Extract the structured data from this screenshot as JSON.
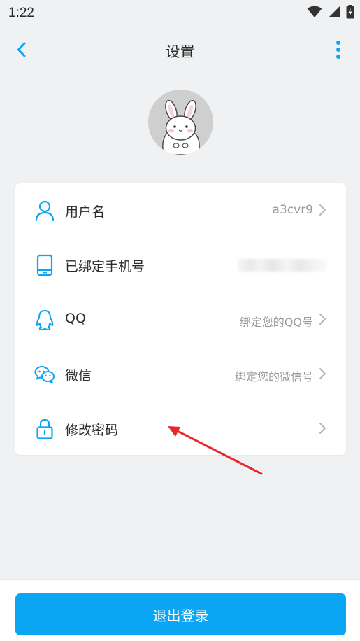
{
  "status_bar": {
    "time": "1:22",
    "icons": [
      "wifi-icon",
      "signal-icon",
      "battery-charging-icon"
    ]
  },
  "header": {
    "title": "设置",
    "back_icon": "chevron-left-icon",
    "more_icon": "more-vertical-icon"
  },
  "profile": {
    "avatar": "rabbit-avatar"
  },
  "settings": {
    "rows": [
      {
        "label": "用户名",
        "value": "a3cvr9",
        "icon": "user-icon"
      },
      {
        "label": "已绑定手机号",
        "value": "",
        "icon": "phone-icon"
      },
      {
        "label": "QQ",
        "value": "绑定您的QQ号",
        "icon": "qq-icon"
      },
      {
        "label": "微信",
        "value": "绑定您的微信号",
        "icon": "wechat-icon"
      },
      {
        "label": "修改密码",
        "value": "",
        "icon": "lock-icon"
      }
    ]
  },
  "footer": {
    "logout_label": "退出登录"
  },
  "colors": {
    "accent": "#0aa6f3",
    "background": "#eff1f2",
    "annotation_arrow": "#e8272a"
  }
}
